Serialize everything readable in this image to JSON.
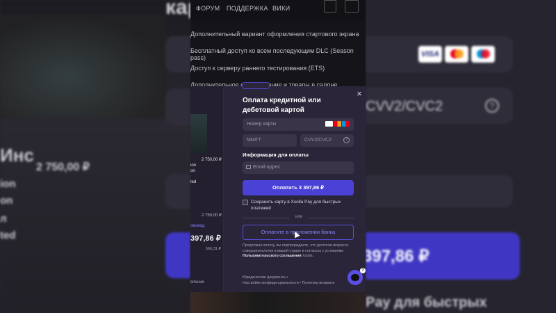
{
  "background": {
    "title_fragment": "карт",
    "left_price": "2 750,00 ₽",
    "left_lines": [
      "ion",
      "on",
      "л",
      "ted"
    ],
    "right_cvv": "CVV2/CVC2",
    "right_total": "397,86 ₽",
    "right_bottom": "Pay для быстрых",
    "left_heading": "Инс"
  },
  "game_page": {
    "nav": [
      "ФОРУМ",
      "ПОДДЕРЖКА",
      "ВИКИ"
    ],
    "features": [
      "Дополнительный вариант оформления стартового экрана",
      "Бесплатный доступ ко всем последующим DLC (Season pass)",
      "Доступ к серверу раннего тестирования (ETS)",
      "Дополнительное оборудование и товары в салоне"
    ]
  },
  "order_pane": {
    "price": "2 750,00 ₽",
    "name_lines": [
      "ion",
      "on",
      "",
      "ted"
    ],
    "subtotal": "2 750,00 ₽",
    "promo": "омокод",
    "total": "397,86 ₽",
    "tax": "566,31 ₽",
    "footer": "вление"
  },
  "modal": {
    "close": "×",
    "title": "Оплата кредитной или дебетовой картой",
    "card_number_placeholder": "Номер карты",
    "expiry_placeholder": "ММ/ГГ",
    "cvv_placeholder": "CVV2/CVC2",
    "cvv_help": "?",
    "billing_label": "Информация для оплаты",
    "email_placeholder": "Email-адрес",
    "pay_button": "Оплатить 3 397,86 ₽",
    "save_card": "Сохранить карту в Xsolla Pay для быстрых платежей",
    "or": "или",
    "app_button": "Оплатите в приложении банка",
    "legal_prefix": "Продолжая оплату, вы подтверждаете, что достигли возраста совершеннолетия в вашей стране и согласны с условиями ",
    "legal_link": "Пользовательского соглашения",
    "legal_suffix": " Xsolla.",
    "footer_line1": "Юридические документы •",
    "footer_line2": "Настройки конфиденциальности • Политика возврата",
    "chat_badge": "?"
  },
  "colors": {
    "accent": "#4a41d6",
    "accent_text": "#8b82ff",
    "modal_bg": "#2a2538",
    "field_bg": "#3a3449",
    "visa": "#ffffff",
    "mastercard_red": "#eb001b",
    "mastercard_orange": "#f79e1b"
  }
}
